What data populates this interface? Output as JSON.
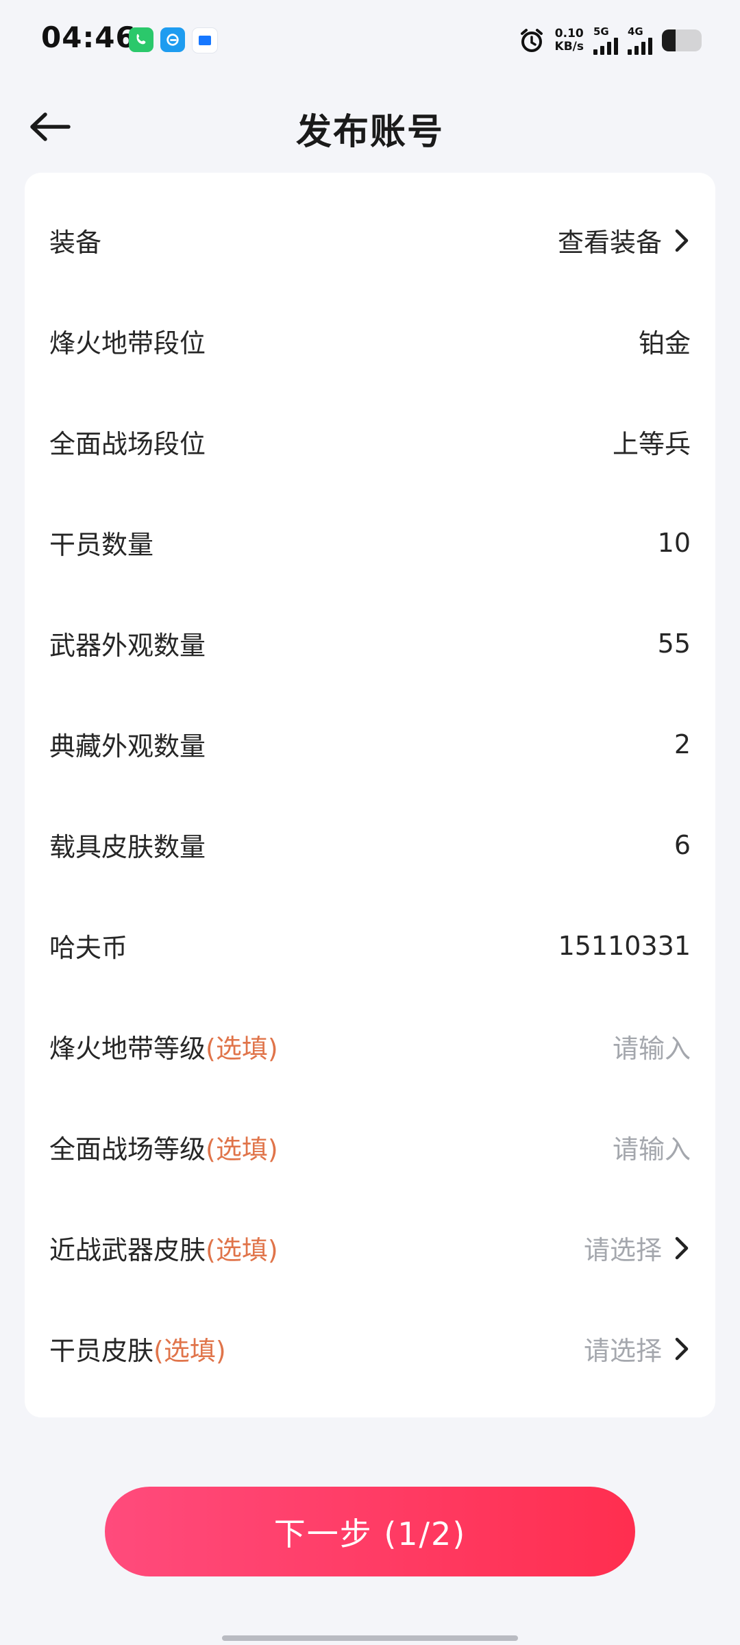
{
  "status_bar": {
    "time": "04:46",
    "net_speed_value": "0.10",
    "net_speed_unit": "KB/s",
    "sim1_label": "5G",
    "sim2_label": "4G",
    "battery_level": 0.35
  },
  "header": {
    "title": "发布账号"
  },
  "form": {
    "optional_tag": "(选填)",
    "rows": [
      {
        "label": "装备",
        "value": "查看装备"
      },
      {
        "label": "烽火地带段位",
        "value": "铂金"
      },
      {
        "label": "全面战场段位",
        "value": "上等兵"
      },
      {
        "label": "干员数量",
        "value": "10"
      },
      {
        "label": "武器外观数量",
        "value": "55"
      },
      {
        "label": "典藏外观数量",
        "value": "2"
      },
      {
        "label": "载具皮肤数量",
        "value": "6"
      },
      {
        "label": "哈夫币",
        "value": "15110331"
      },
      {
        "label": "烽火地带等级",
        "placeholder": "请输入"
      },
      {
        "label": "全面战场等级",
        "placeholder": "请输入"
      },
      {
        "label": "近战武器皮肤",
        "placeholder": "请选择"
      },
      {
        "label": "干员皮肤",
        "placeholder": "请选择"
      }
    ]
  },
  "footer": {
    "next_label": "下一步 (1/2)"
  },
  "colors": {
    "accent": "#ff3c62",
    "optional": "#e0744a",
    "placeholder": "#a4a7ad",
    "background": "#f4f5f9"
  }
}
